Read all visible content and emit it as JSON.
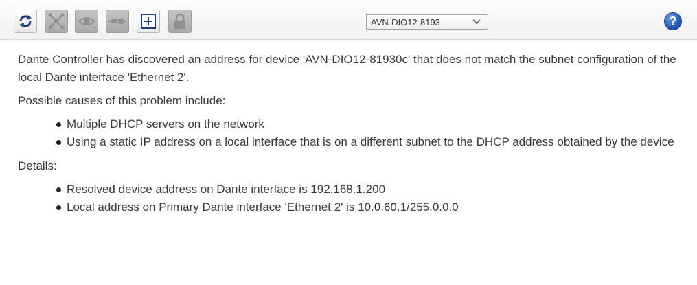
{
  "toolbar": {
    "buttons": [
      {
        "icon": "refresh-icon",
        "state": "enabled"
      },
      {
        "icon": "network-icon",
        "state": "disabled"
      },
      {
        "icon": "eye-icon",
        "state": "disabled"
      },
      {
        "icon": "plug-icon",
        "state": "disabled"
      },
      {
        "icon": "expand-plus-icon",
        "state": "enabled"
      },
      {
        "icon": "lock-icon",
        "state": "disabled"
      }
    ],
    "device_select": {
      "selected": "AVN-DIO12-8193"
    },
    "help_label": "?"
  },
  "message": {
    "intro": "Dante Controller has discovered an address for device 'AVN-DIO12-81930c' that does not match the subnet configuration of the local Dante interface 'Ethernet 2'.",
    "causes_heading": "Possible causes of this problem include:",
    "causes": [
      "Multiple DHCP servers on the network",
      "Using a static IP address on a local interface that is on a different subnet to the DHCP address obtained by the device"
    ],
    "details_heading": "Details:",
    "details": [
      "Resolved device address on Dante interface is 192.168.1.200",
      "Local address on Primary Dante interface 'Ethernet 2' is 10.0.60.1/255.0.0.0"
    ]
  },
  "colors": {
    "toolbar_bg": "#f4f4f4",
    "disabled_button": "#b5b5b5",
    "help_blue": "#1c4ea8",
    "text": "#3a3a3a"
  }
}
